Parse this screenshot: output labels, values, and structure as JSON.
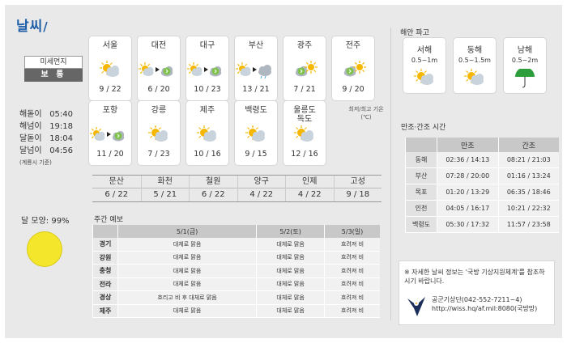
{
  "header": {
    "logo": "날씨"
  },
  "dust": {
    "label": "미세먼지",
    "value": "보 통"
  },
  "sun_moon": [
    {
      "label": "해돋이",
      "time": "05:40"
    },
    {
      "label": "해넘이",
      "time": "19:18"
    },
    {
      "label": "달돋이",
      "time": "18:04"
    },
    {
      "label": "달넘이",
      "time": "04:56"
    }
  ],
  "sun_moon_note": "(계룡시 기준)",
  "moon": {
    "label": "달 모양: 99%",
    "phase_percent": 99,
    "color": "#f4e62a"
  },
  "forecast_cards": [
    {
      "city": "서울",
      "temps": "9 / 22",
      "icon": "sun-cloud-icon"
    },
    {
      "city": "대전",
      "temps": "6 / 20",
      "icon": "sun-to-cloud-icon"
    },
    {
      "city": "대구",
      "temps": "10 / 23",
      "icon": "sun-to-cloud-icon"
    },
    {
      "city": "부산",
      "temps": "13 / 21",
      "icon": "sun-to-rain-icon"
    },
    {
      "city": "광주",
      "temps": "7 / 21",
      "icon": "cloud-sun-icon"
    },
    {
      "city": "전주",
      "temps": "9 / 20",
      "icon": "cloud-sun-icon"
    },
    {
      "city": "포항",
      "temps": "11 / 20",
      "icon": "sun-to-cloud-icon"
    },
    {
      "city": "강릉",
      "temps": "7 / 23",
      "icon": "sun-cloud-icon"
    },
    {
      "city": "제주",
      "temps": "10 / 16",
      "icon": "sun-cloud-icon"
    },
    {
      "city": "백령도",
      "temps": "9 / 15",
      "icon": "sun-cloud-icon"
    },
    {
      "city": "울릉도\n독도",
      "temps": "12 / 16",
      "icon": "sun-cloud-icon"
    }
  ],
  "minmax_label": "최저/최고 기온\n(℃)",
  "cities_row": [
    {
      "city": "문산",
      "temps": "6 / 22"
    },
    {
      "city": "화천",
      "temps": "5 / 21"
    },
    {
      "city": "철원",
      "temps": "6 / 22"
    },
    {
      "city": "양구",
      "temps": "4 / 22"
    },
    {
      "city": "인제",
      "temps": "4 / 22"
    },
    {
      "city": "고성",
      "temps": "9 / 18"
    }
  ],
  "weekly": {
    "title": "주간 예보",
    "days": [
      "5/1(금)",
      "5/2(토)",
      "5/3(일)"
    ],
    "rows": [
      {
        "region": "경기",
        "values": [
          "대체로 맑음",
          "대체로 맑음",
          "흐려져 비"
        ]
      },
      {
        "region": "강원",
        "values": [
          "대체로 맑음",
          "대체로 맑음",
          "흐려져 비"
        ]
      },
      {
        "region": "충청",
        "values": [
          "대체로 맑음",
          "대체로 맑음",
          "흐려져 비"
        ]
      },
      {
        "region": "전라",
        "values": [
          "대체로 맑음",
          "대체로 맑음",
          "흐려져 비"
        ]
      },
      {
        "region": "경상",
        "values": [
          "흐리고 비 후 대체로 맑음",
          "대체로 맑음",
          "흐려져 비"
        ]
      },
      {
        "region": "제주",
        "values": [
          "대체로 맑음",
          "대체로 맑음",
          "흐려져 비"
        ]
      }
    ]
  },
  "sea": {
    "title": "해안 파고",
    "cards": [
      {
        "name": "서해",
        "wave": "0.5~1m",
        "icon": "sun-cloud-icon"
      },
      {
        "name": "동해",
        "wave": "0.5~1.5m",
        "icon": "sun-cloud-icon"
      },
      {
        "name": "남해",
        "wave": "0.5~2m",
        "icon": "umbrella-icon"
      }
    ]
  },
  "tide": {
    "title": "만조·간조 시간",
    "headers": [
      "만조",
      "간조"
    ],
    "rows": [
      {
        "site": "동해",
        "high": "02:36 / 14:13",
        "low": "08:21 / 21:03"
      },
      {
        "site": "부산",
        "high": "07:28 / 20:00",
        "low": "01:16 / 13:24"
      },
      {
        "site": "목포",
        "high": "01:20 / 13:29",
        "low": "06:35 / 18:46"
      },
      {
        "site": "인천",
        "high": "04:05 / 16:17",
        "low": "10:21 / 22:32"
      },
      {
        "site": "백령도",
        "high": "05:30 / 17:32",
        "low": "11:57 / 23:58"
      }
    ]
  },
  "info": {
    "note": "※ 자세한 날씨 정보는 '국방 기상지원체계'를 참조하시기 바랍니다.",
    "contact_line1": "공군기상단(042-552-7211~4)",
    "contact_line2": "http://wiss.hq/af.mil:8080(국방망)"
  },
  "colors": {
    "sun": "#f5b700",
    "cloud": "#c9d3dc",
    "rain": "#4aa8d8",
    "umbrella": "#2e9e3d",
    "brand": "#1f5fa8"
  }
}
